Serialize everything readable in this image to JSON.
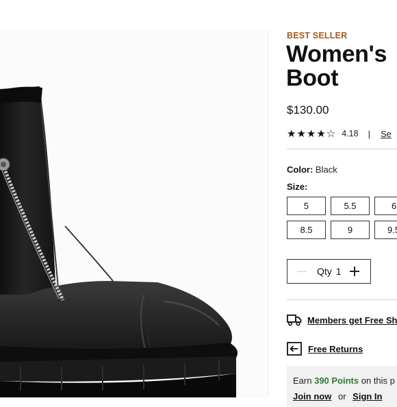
{
  "product": {
    "badge": "BEST SELLER",
    "title": "Women's\nBoot",
    "price": "$130.00",
    "rating": {
      "stars_filled": 4,
      "stars_total": 5,
      "stars_display": "★★★★☆",
      "value": "4.18",
      "separator": "|",
      "reviews_link": "Se"
    }
  },
  "color": {
    "label": "Color:",
    "value": "Black"
  },
  "size": {
    "label": "Size:",
    "options": [
      "5",
      "5.5",
      "6",
      "8.5",
      "9",
      "9.5"
    ]
  },
  "quantity": {
    "label": "Qty",
    "value": "1"
  },
  "perks": {
    "shipping": "Members get Free Sh",
    "returns": "Free Returns"
  },
  "points": {
    "earn_prefix": "Earn",
    "points_value": "390 Points",
    "earn_suffix": "on this p",
    "join_label": "Join now",
    "or_label": "or",
    "signin_label": "Sign In"
  },
  "colors": {
    "badge": "#a15a1c",
    "points_accent": "#2f7d32"
  },
  "icons": {
    "minus": "minus-icon",
    "plus": "plus-icon",
    "truck": "truck-icon",
    "return": "return-box-icon"
  }
}
